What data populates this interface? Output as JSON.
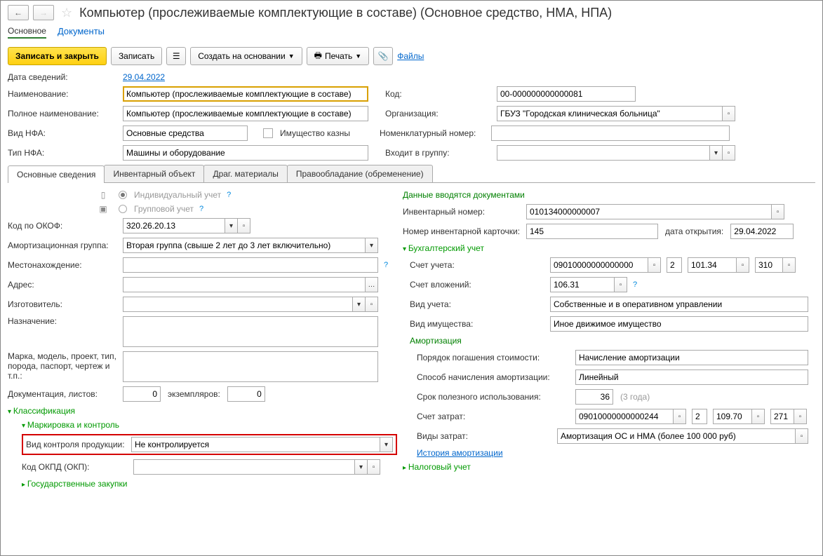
{
  "title": "Компьютер (прослеживаемые комплектующие в составе) (Основное средство, НМА, НПА)",
  "topnav": {
    "main": "Основное",
    "docs": "Документы"
  },
  "toolbar": {
    "save_close": "Записать и закрыть",
    "save": "Записать",
    "create_based": "Создать на основании",
    "print": "Печать",
    "files": "Файлы"
  },
  "labels": {
    "date": "Дата сведений:",
    "name": "Наименование:",
    "fullname": "Полное наименование:",
    "nfa_type": "Вид НФА:",
    "treasury": "Имущество казны",
    "nfa_kind": "Тип НФА:",
    "code": "Код:",
    "org": "Организация:",
    "nomencl": "Номенклатурный номер:",
    "group": "Входит в группу:"
  },
  "values": {
    "date": "29.04.2022",
    "name": "Компьютер (прослеживаемые комплектующие в составе)",
    "fullname": "Компьютер (прослеживаемые комплектующие в составе)",
    "nfa_type": "Основные средства",
    "nfa_kind": "Машины и оборудование",
    "code": "00-000000000000081",
    "org": "ГБУЗ \"Городская клиническая больница\""
  },
  "tabs": {
    "t1": "Основные сведения",
    "t2": "Инвентарный объект",
    "t3": "Драг. материалы",
    "t4": "Правообладание (обременение)"
  },
  "left": {
    "individual": "Индивидуальный учет",
    "group": "Групповой учет",
    "okof_lbl": "Код по ОКОФ:",
    "okof": "320.26.20.13",
    "amgroup_lbl": "Амортизационная группа:",
    "amgroup": "Вторая группа (свыше 2 лет до 3 лет включительно)",
    "location_lbl": "Местонахождение:",
    "address_lbl": "Адрес:",
    "maker_lbl": "Изготовитель:",
    "purpose_lbl": "Назначение:",
    "model_lbl": "Марка, модель, проект, тип, порода, паспорт, чертеж и т.п.:",
    "docs_lbl": "Документация, листов:",
    "docs_val": "0",
    "copies_lbl": "экземпляров:",
    "copies_val": "0",
    "classification": "Классификация",
    "marking": "Маркировка и контроль",
    "control_lbl": "Вид контроля продукции:",
    "control_val": "Не контролируется",
    "okpd_lbl": "Код ОКПД (ОКП):",
    "gov": "Государственные закупки"
  },
  "right": {
    "docs_entered": "Данные вводятся документами",
    "inv_lbl": "Инвентарный номер:",
    "inv": "010134000000007",
    "card_lbl": "Номер инвентарной карточки:",
    "card": "145",
    "open_lbl": "дата открытия:",
    "open": "29.04.2022",
    "accounting": "Бухгалтерский учет",
    "acct_lbl": "Счет учета:",
    "acct1": "09010000000000000",
    "acct2": "2",
    "acct3": "101.34",
    "acct4": "310",
    "invest_lbl": "Счет вложений:",
    "invest": "106.31",
    "accttype_lbl": "Вид учета:",
    "accttype": "Собственные и в оперативном управлении",
    "property_lbl": "Вид имущества:",
    "property": "Иное движимое имущество",
    "amortization": "Амортизация",
    "repay_lbl": "Порядок погашения стоимости:",
    "repay": "Начисление амортизации",
    "method_lbl": "Способ начисления амортизации:",
    "method": "Линейный",
    "life_lbl": "Срок полезного использования:",
    "life": "36",
    "life_note": "(3 года)",
    "cost_lbl": "Счет затрат:",
    "cost1": "09010000000000244",
    "cost2": "2",
    "cost3": "109.70",
    "cost4": "271",
    "costtype_lbl": "Виды затрат:",
    "costtype": "Амортизация ОС и НМА (более 100 000 руб)",
    "history": "История амортизации",
    "tax": "Налоговый учет"
  }
}
